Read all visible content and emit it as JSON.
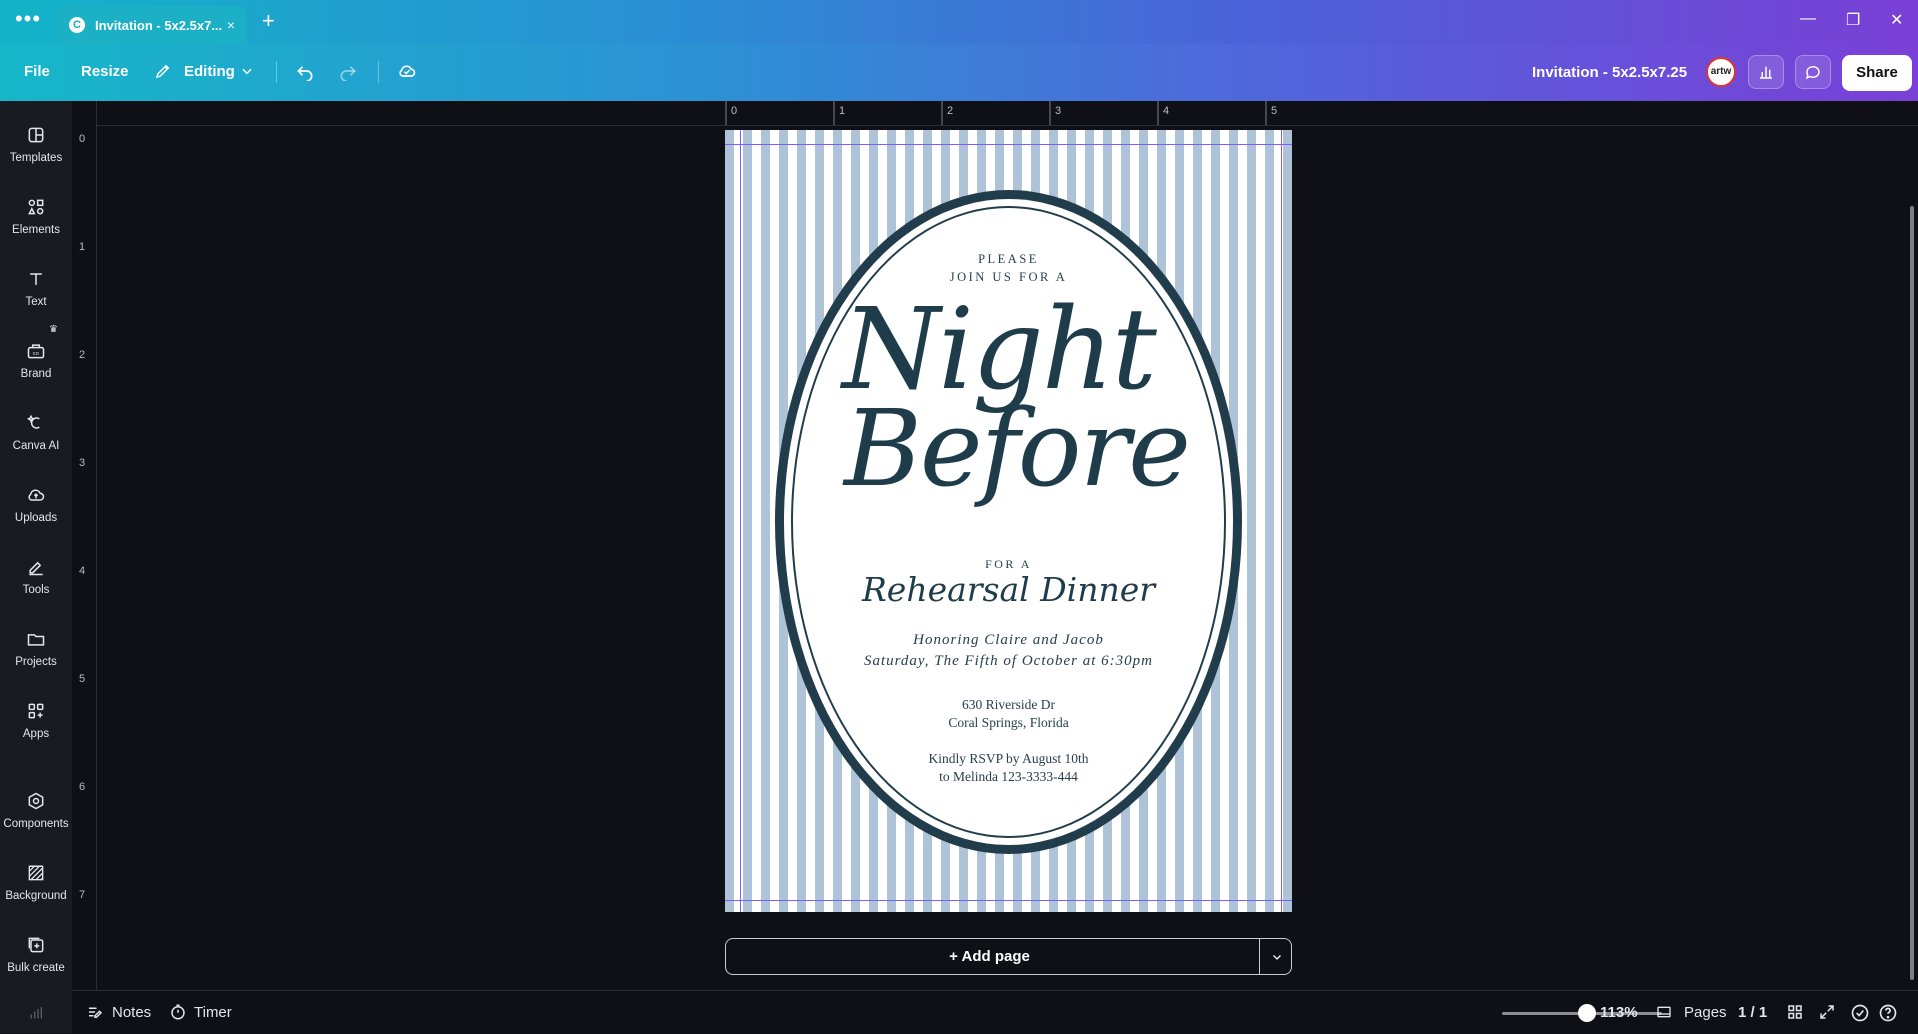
{
  "browser": {
    "tab_title": "Invitation - 5x2.5x7...",
    "tab_close": "×",
    "new_tab": "+",
    "window_controls": [
      "—",
      "❐",
      "✕"
    ]
  },
  "toolbar": {
    "file_label": "File",
    "resize_label": "Resize",
    "editing_label": "Editing",
    "document_title": "Invitation - 5x2.5x7.25",
    "avatar_text": "artw",
    "share_label": "Share"
  },
  "sidebar": {
    "items": [
      {
        "label": "Templates"
      },
      {
        "label": "Elements"
      },
      {
        "label": "Text"
      },
      {
        "label": "Brand"
      },
      {
        "label": "Canva AI"
      },
      {
        "label": "Uploads"
      },
      {
        "label": "Tools"
      },
      {
        "label": "Projects"
      },
      {
        "label": "Apps"
      },
      {
        "label": "Components"
      },
      {
        "label": "Background"
      },
      {
        "label": "Bulk create"
      }
    ]
  },
  "rulers": {
    "top": [
      "0",
      "1",
      "2",
      "3",
      "4",
      "5"
    ],
    "left": [
      "0",
      "1",
      "2",
      "3",
      "4",
      "5",
      "6",
      "7"
    ]
  },
  "invitation": {
    "line1": "PLEASE",
    "line2": "JOIN US FOR A",
    "title1": "Night",
    "title2": "Before",
    "for_a": "FOR A",
    "subtitle": "Rehearsal Dinner",
    "honoring": "Honoring Claire and Jacob",
    "date": "Saturday, The Fifth of October at 6:30pm",
    "address1": "630 Riverside Dr",
    "address2": "Coral Springs, Florida",
    "rsvp1": "Kindly RSVP by August 10th",
    "rsvp2": "to Melinda 123-3333-444"
  },
  "add_page": {
    "label": "+ Add page"
  },
  "bottom": {
    "notes_label": "Notes",
    "timer_label": "Timer",
    "zoom_value": "113%",
    "zoom_fraction": 0.53,
    "pages_label": "Pages",
    "page_count": "1 / 1"
  },
  "colors": {
    "accent_gradient_start": "#13b3c8",
    "accent_gradient_end": "#7a3fd6",
    "stripe_blue": "#aec3d8",
    "ink_navy": "#213d4c",
    "guide_purple": "#7b5cff"
  }
}
